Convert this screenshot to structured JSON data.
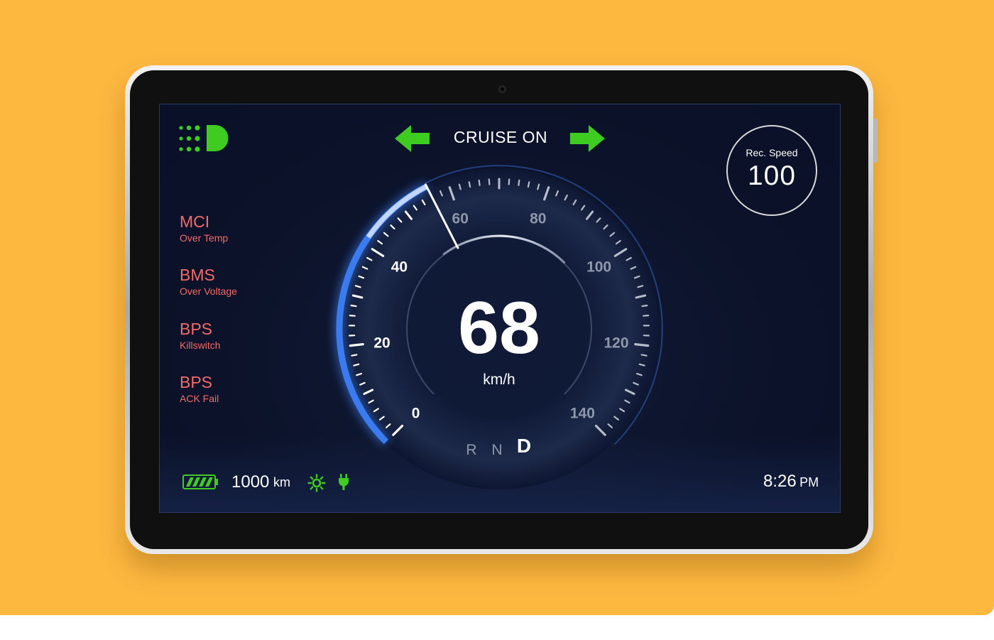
{
  "cruise": {
    "label": "CRUISE ON"
  },
  "faults": [
    {
      "code": "MCI",
      "description": "Over Temp"
    },
    {
      "code": "BMS",
      "description": "Over Voltage"
    },
    {
      "code": "BPS",
      "description": "Killswitch"
    },
    {
      "code": "BPS",
      "description": "ACK Fail"
    }
  ],
  "recommended_speed": {
    "label": "Rec. Speed",
    "value": "100"
  },
  "speedometer": {
    "speed": "68",
    "unit": "km/h",
    "needle_value": 56,
    "scale_min": 0,
    "scale_max": 140,
    "tick_labels": [
      "0",
      "20",
      "40",
      "60",
      "80",
      "100",
      "120",
      "140"
    ]
  },
  "gears": {
    "options": [
      "R",
      "N",
      "D"
    ],
    "selected": "D"
  },
  "footer": {
    "range_value": "1000",
    "range_unit": "km",
    "battery_level": 1.0,
    "time": "8:26",
    "time_suffix": "PM"
  },
  "colors": {
    "indicator_green": "#3DCC1F",
    "fault_red": "#F36A6A",
    "arc_blue": "#3A7BEF",
    "screen_bg": "#0B1229",
    "backdrop": "#FDB840"
  },
  "icons": {
    "headlight": "headlight-icon",
    "turn_left": "arrow-left-icon",
    "turn_right": "arrow-right-icon",
    "battery": "battery-icon",
    "daylight": "sun-icon",
    "charging": "plug-icon"
  }
}
